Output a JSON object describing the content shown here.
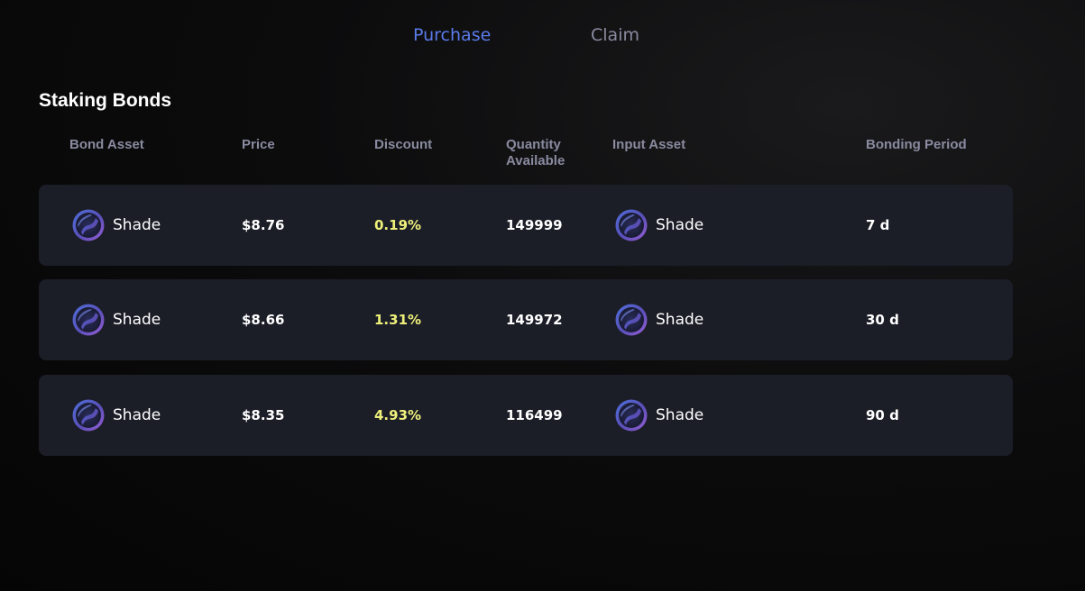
{
  "tabs": {
    "purchase": {
      "label": "Purchase",
      "color": "#5b7bea",
      "active": true
    },
    "claim": {
      "label": "Claim",
      "color": "#8a8aa0",
      "active": false
    }
  },
  "section": {
    "title": "Staking Bonds"
  },
  "columns": {
    "bond_asset": "Bond Asset",
    "price": "Price",
    "discount": "Discount",
    "quantity": "Quantity Available",
    "input_asset": "Input Asset",
    "bonding_period": "Bonding Period"
  },
  "bonds": [
    {
      "bond_asset": "Shade",
      "bond_icon": "shade-coin-icon",
      "price": "$8.76",
      "discount": "0.19%",
      "quantity": "149999",
      "input_asset": "Shade",
      "input_icon": "shade-coin-icon",
      "period": "7 d"
    },
    {
      "bond_asset": "Shade",
      "bond_icon": "shade-coin-icon",
      "price": "$8.66",
      "discount": "1.31%",
      "quantity": "149972",
      "input_asset": "Shade",
      "input_icon": "shade-coin-icon",
      "period": "30 d"
    },
    {
      "bond_asset": "Shade",
      "bond_icon": "shade-coin-icon",
      "price": "$8.35",
      "discount": "4.93%",
      "quantity": "116499",
      "input_asset": "Shade",
      "input_icon": "shade-coin-icon",
      "period": "90 d"
    }
  ],
  "colors": {
    "row_background": "#1b1d27",
    "header_text": "#8a8aa0",
    "discount_text": "#eef07a",
    "accent": "#5b7bea"
  }
}
